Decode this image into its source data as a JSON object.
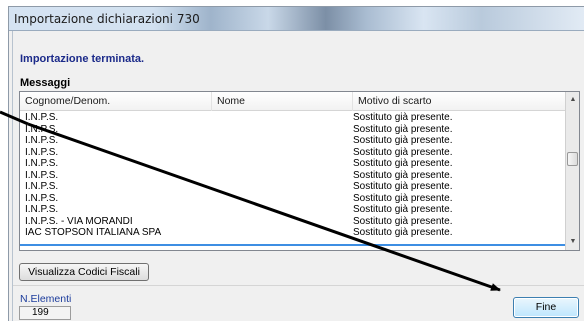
{
  "window": {
    "title": "Importazione dichiarazioni 730"
  },
  "status": {
    "message": "Importazione terminata."
  },
  "messages": {
    "label": "Messaggi",
    "columns": [
      "Cognome/Denom.",
      "Nome",
      "Motivo di scarto"
    ],
    "rows": [
      [
        "I.N.P.S.",
        "",
        "Sostituto già presente."
      ],
      [
        "I.N.P.S.",
        "",
        "Sostituto già presente."
      ],
      [
        "I.N.P.S.",
        "",
        "Sostituto già presente."
      ],
      [
        "I.N.P.S.",
        "",
        "Sostituto già presente."
      ],
      [
        "I.N.P.S.",
        "",
        "Sostituto già presente."
      ],
      [
        "I.N.P.S.",
        "",
        "Sostituto già presente."
      ],
      [
        "I.N.P.S.",
        "",
        "Sostituto già presente."
      ],
      [
        "I.N.P.S.",
        "",
        "Sostituto già presente."
      ],
      [
        "I.N.P.S.",
        "",
        "Sostituto già presente."
      ],
      [
        "I.N.P.S. - VIA MORANDI",
        "",
        "Sostituto già presente."
      ],
      [
        "IAC STOPSON ITALIANA SPA",
        "",
        "Sostituto già presente."
      ]
    ]
  },
  "buttons": {
    "codici": "Visualizza Codici Fiscali",
    "fine": "Fine"
  },
  "elements": {
    "label": "N.Elementi",
    "count": "199"
  },
  "colors": {
    "accent": "#3d8ee3",
    "status_text": "#1c2b8a"
  },
  "icons": {
    "scroll_up": "scroll-up-icon",
    "scroll_down": "scroll-down-icon"
  }
}
